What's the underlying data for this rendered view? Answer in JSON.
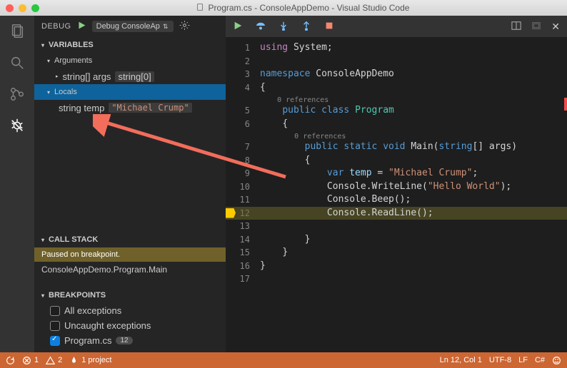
{
  "window": {
    "title": "Program.cs - ConsoleAppDemo - Visual Studio Code",
    "file_icon": "file-icon"
  },
  "debug_panel": {
    "label": "DEBUG",
    "config": "Debug ConsoleAp",
    "sections": {
      "variables": {
        "title": "VARIABLES"
      },
      "arguments": {
        "title": "Arguments",
        "items": [
          {
            "name": "string[] args",
            "value": "string[0]"
          }
        ]
      },
      "locals": {
        "title": "Locals",
        "items": [
          {
            "name": "string temp",
            "value": "\"Michael Crump\""
          }
        ]
      },
      "callstack": {
        "title": "CALL STACK",
        "status": "Paused on breakpoint.",
        "frames": [
          "ConsoleAppDemo.Program.Main"
        ]
      },
      "breakpoints": {
        "title": "BREAKPOINTS",
        "items": [
          {
            "label": "All exceptions",
            "checked": false
          },
          {
            "label": "Uncaught exceptions",
            "checked": false
          },
          {
            "label": "Program.cs",
            "checked": true,
            "badge": "12"
          }
        ]
      }
    }
  },
  "editor": {
    "code_references": {
      "class": "0 references",
      "method": "0 references"
    },
    "lines": [
      {
        "n": 1,
        "txt_html": "<span class='k-using'>using</span> <span class='k-plain'>System;</span>"
      },
      {
        "n": 2,
        "txt_html": ""
      },
      {
        "n": 3,
        "txt_html": "<span class='k-kw'>namespace</span> <span class='k-plain'>ConsoleAppDemo</span>"
      },
      {
        "n": 4,
        "txt_html": "<span class='k-punc'>{</span>",
        "indent": 0
      },
      {
        "n": 5,
        "txt_html": "    <span class='k-kw'>public class</span> <span class='k-id'>Program</span>",
        "ref_above": "class"
      },
      {
        "n": 6,
        "txt_html": "    <span class='k-punc'>{</span>"
      },
      {
        "n": 7,
        "txt_html": "        <span class='k-kw'>public static void</span> <span class='k-plain'>Main(</span><span class='k-kw'>string</span><span class='k-plain'>[] args)</span>",
        "ref_above": "method"
      },
      {
        "n": 8,
        "txt_html": "        <span class='k-punc'>{</span>"
      },
      {
        "n": 9,
        "txt_html": "            <span class='k-kw'>var</span> <span class='k-var'>temp</span> <span class='k-punc'>=</span> <span class='k-str'>\"Michael Crump\"</span><span class='k-punc'>;</span>"
      },
      {
        "n": 10,
        "txt_html": "            <span class='k-plain'>Console.WriteLine(</span><span class='k-str'>\"Hello World\"</span><span class='k-plain'>);</span>"
      },
      {
        "n": 11,
        "txt_html": "            <span class='k-plain'>Console.Beep();</span>"
      },
      {
        "n": 12,
        "txt_html": "            <span class='k-plain'>Console.ReadLine();</span>",
        "highlight": true,
        "breakpoint": true
      },
      {
        "n": 13,
        "txt_html": ""
      },
      {
        "n": 14,
        "txt_html": "        <span class='k-punc'>}</span>"
      },
      {
        "n": 15,
        "txt_html": "    <span class='k-punc'>}</span>"
      },
      {
        "n": 16,
        "txt_html": "<span class='k-punc'>}</span>"
      },
      {
        "n": 17,
        "txt_html": ""
      }
    ]
  },
  "statusbar": {
    "errors": "1",
    "warnings": "2",
    "projects": "1 project",
    "cursor": "Ln 12, Col 1",
    "encoding": "UTF-8",
    "eol": "LF",
    "lang": "C#"
  }
}
